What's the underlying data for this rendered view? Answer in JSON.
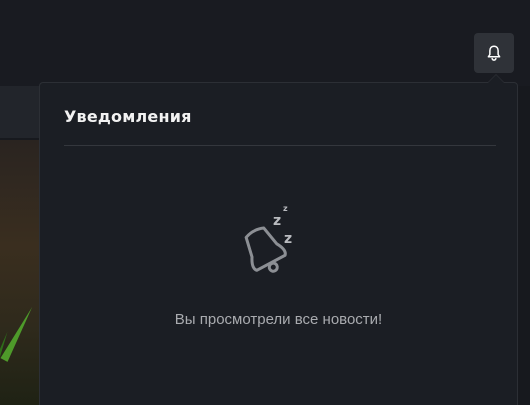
{
  "header": {
    "notifications_icon": "bell-icon"
  },
  "notifications": {
    "title": "Уведомления",
    "empty_icon": "sleeping-bell-icon",
    "sleep_glyphs": [
      "z",
      "z",
      "z"
    ],
    "empty_message": "Вы просмотрели все новости!"
  },
  "colors": {
    "page_background": "#17191e",
    "panel_background": "#1b1e24",
    "button_background": "#2f3238",
    "title_text": "#f2f2f2",
    "body_text": "#a9abaf",
    "icon_gray": "#8c8f94"
  }
}
